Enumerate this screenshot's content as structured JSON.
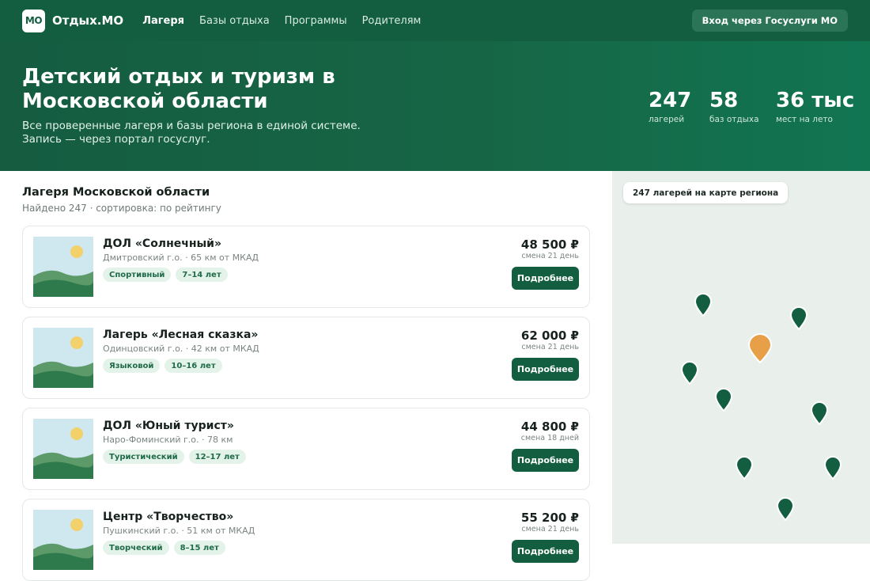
{
  "brand": {
    "badge": "МО",
    "name": "Отдых.МО"
  },
  "nav": {
    "links": [
      {
        "label": "Лагеря",
        "active": true
      },
      {
        "label": "Базы отдыха",
        "active": false
      },
      {
        "label": "Программы",
        "active": false
      },
      {
        "label": "Родителям",
        "active": false
      }
    ],
    "login_button": "Вход через Госуслуги МО"
  },
  "hero": {
    "title": "Детский отдых и туризм в Московской области",
    "subtitle": "Все проверенные лагеря и базы региона в единой системе. Запись — через портал госуслуг.",
    "stats": [
      {
        "value": "247",
        "label": "лагерей"
      },
      {
        "value": "58",
        "label": "баз отдыха"
      },
      {
        "value": "36 тыс",
        "label": "мест на лето"
      }
    ]
  },
  "list": {
    "title": "Лагеря Московской области",
    "meta": "Найдено 247 · сортировка: по рейтингу",
    "cards": [
      {
        "name": "ДОЛ «Солнечный»",
        "location": "Дмитровский г.о. · 65 км от МКАД",
        "tags": [
          "Спортивный",
          "7–14 лет"
        ],
        "price": "48 500 ₽",
        "shift": "смена 21 день",
        "button": "Подробнее"
      },
      {
        "name": "Лагерь «Лесная сказка»",
        "location": "Одинцовский г.о. · 42 км от МКАД",
        "tags": [
          "Языковой",
          "10–16 лет"
        ],
        "price": "62 000 ₽",
        "shift": "смена 21 день",
        "button": "Подробнее"
      },
      {
        "name": "ДОЛ «Юный турист»",
        "location": "Наро-Фоминский г.о. · 78 км",
        "tags": [
          "Туристический",
          "12–17 лет"
        ],
        "price": "44 800 ₽",
        "shift": "смена 18 дней",
        "button": "Подробнее"
      },
      {
        "name": "Центр «Творчество»",
        "location": "Пушкинский г.о. · 51 км от МКАД",
        "tags": [
          "Творческий",
          "8–15 лет"
        ],
        "price": "55 200 ₽",
        "shift": "смена 21 день",
        "button": "Подробнее"
      }
    ]
  },
  "map": {
    "chip": "247 лагерей на карте региона",
    "pin_color": "#135e40",
    "highlight_color": "#e8a048"
  },
  "colors": {
    "brand": "#135e40",
    "tag_bg": "#e4f3ea",
    "tag_text": "#1f6b47"
  }
}
